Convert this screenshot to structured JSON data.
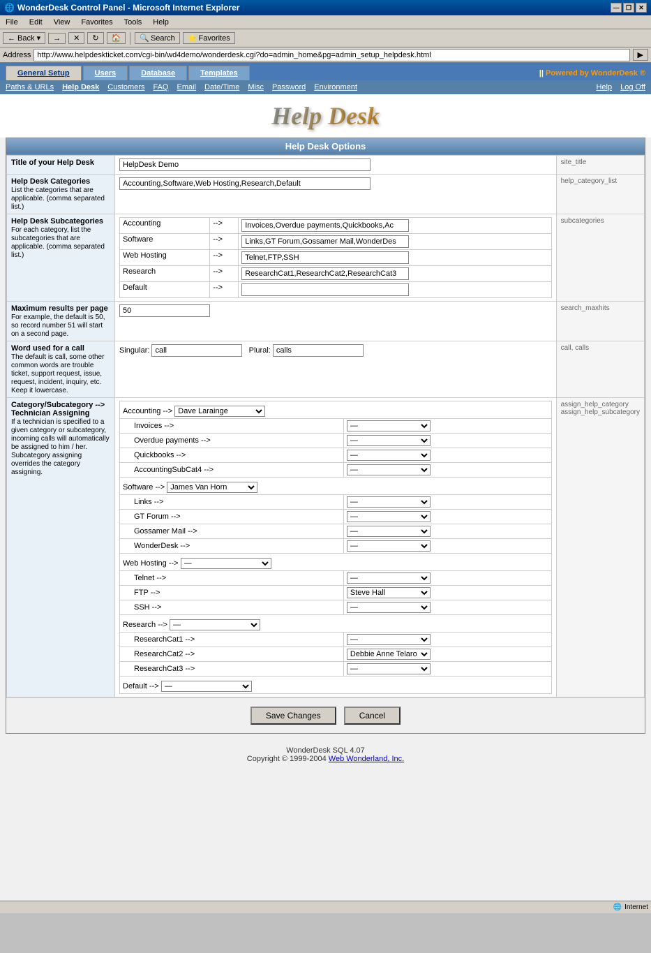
{
  "window": {
    "title": "WonderDesk Control Panel - Microsoft Internet Explorer",
    "controls": {
      "minimize": "—",
      "restore": "❐",
      "close": "✕"
    }
  },
  "menu": {
    "items": [
      "File",
      "Edit",
      "View",
      "Favorites",
      "Tools",
      "Help"
    ]
  },
  "toolbar": {
    "back": "← Back",
    "forward": "→",
    "stop": "✕",
    "refresh": "↻",
    "search": "Search",
    "favorites": "Favorites"
  },
  "address": {
    "label": "Address",
    "url": "http://www.helpdeskticket.com/cgi-bin/wd4demo/wonderdesk.cgi?do=admin_home&pg=admin_setup_helpdesk.html"
  },
  "nav_tabs": {
    "items": [
      {
        "label": "General Setup",
        "active": true
      },
      {
        "label": "Users",
        "active": false
      },
      {
        "label": "Database",
        "active": false
      },
      {
        "label": "Templates",
        "active": false
      }
    ],
    "powered": "Powered by WonderDesk ®"
  },
  "sub_nav": {
    "left_items": [
      {
        "label": "Paths & URLs"
      },
      {
        "label": "Help Desk",
        "active": true
      },
      {
        "label": "Customers"
      },
      {
        "label": "FAQ"
      },
      {
        "label": "Email"
      },
      {
        "label": "Date/Time"
      },
      {
        "label": "Misc"
      },
      {
        "label": "Password"
      },
      {
        "label": "Environment"
      }
    ],
    "right_items": [
      {
        "label": "Help"
      },
      {
        "label": "Log Off"
      }
    ]
  },
  "logo": "Help Desk",
  "section_title": "Help Desk Options",
  "fields": {
    "title_label": "Title of your Help Desk",
    "title_value": "HelpDesk Demo",
    "title_code": "site_title",
    "categories_label": "Help Desk Categories",
    "categories_sublabel": "List the categories that are applicable. (comma separated list.)",
    "categories_value": "Accounting,Software,Web Hosting,Research,Default",
    "categories_code": "help_category_list",
    "subcategories_label": "Help Desk Subcategories",
    "subcategories_sublabel": "For each category, list the subcategories that are applicable. (comma separated list.)",
    "subcategories_code": "subcategories",
    "subcategories_rows": [
      {
        "cat": "Accounting",
        "arrow": "-->",
        "value": "Invoices,Overdue payments,Quickbooks,Ac"
      },
      {
        "cat": "Software",
        "arrow": "-->",
        "value": "Links,GT Forum,Gossamer Mail,WonderDes"
      },
      {
        "cat": "Web Hosting",
        "arrow": "-->",
        "value": "Telnet,FTP,SSH"
      },
      {
        "cat": "Research",
        "arrow": "-->",
        "value": "ResearchCat1,ResearchCat2,ResearchCat3"
      },
      {
        "cat": "Default",
        "arrow": "-->",
        "value": ""
      }
    ],
    "maxresults_label": "Maximum results per page",
    "maxresults_sublabel": "For example, the default is 50, so record number 51 will start on a second page.",
    "maxresults_value": "50",
    "maxresults_code": "search_maxhits",
    "wordcall_label": "Word used for a call",
    "wordcall_sublabel": "The default is call, some other common words are trouble ticket, support request, issue, request, incident, inquiry, etc. Keep it lowercase.",
    "wordcall_singular_label": "Singular:",
    "wordcall_singular_value": "call",
    "wordcall_plural_label": "Plural:",
    "wordcall_plural_value": "calls",
    "wordcall_code": "call, calls",
    "assign_label": "Category/Subcategory --> Technician Assigning",
    "assign_sublabel": "If a technician is specified to a given category or subcategory, incoming calls will automatically be assigned to him / her. Subcategory assigning overrides the category assigning.",
    "assign_code_label": "assign_help_category",
    "assign_code_sublabel": "assign_help_subcategory",
    "assign_rows": [
      {
        "category": "Accounting",
        "category_select": "Dave Larainge",
        "subcategories": [
          {
            "name": "Invoices -->",
            "value": "—"
          },
          {
            "name": "Overdue payments -->",
            "value": "—"
          },
          {
            "name": "Quickbooks -->",
            "value": "—"
          },
          {
            "name": "AccountingSubCat4 -->",
            "value": "—"
          }
        ]
      },
      {
        "category": "Software",
        "category_select": "James Van Horn",
        "subcategories": [
          {
            "name": "Links -->",
            "value": "—"
          },
          {
            "name": "GT Forum -->",
            "value": "—"
          },
          {
            "name": "Gossamer Mail -->",
            "value": "—"
          },
          {
            "name": "WonderDesk -->",
            "value": "—"
          }
        ]
      },
      {
        "category": "Web Hosting",
        "category_select": "—",
        "subcategories": [
          {
            "name": "Telnet -->",
            "value": "—"
          },
          {
            "name": "FTP -->",
            "value": "Steve Hall"
          },
          {
            "name": "SSH -->",
            "value": "—"
          }
        ]
      },
      {
        "category": "Research",
        "category_select": "—",
        "subcategories": [
          {
            "name": "ResearchCat1 -->",
            "value": "—"
          },
          {
            "name": "ResearchCat2 -->",
            "value": "Debbie Anne Telaro"
          },
          {
            "name": "ResearchCat3 -->",
            "value": "—"
          }
        ]
      },
      {
        "category": "Default",
        "category_select": "—",
        "subcategories": []
      }
    ]
  },
  "buttons": {
    "save": "Save Changes",
    "cancel": "Cancel"
  },
  "footer": {
    "line1": "WonderDesk SQL 4.07",
    "line2": "Copyright © 1999-2004",
    "link_text": "Web Wonderland, Inc.",
    "link_url": "#"
  },
  "status": {
    "left": "",
    "right": "Internet"
  }
}
